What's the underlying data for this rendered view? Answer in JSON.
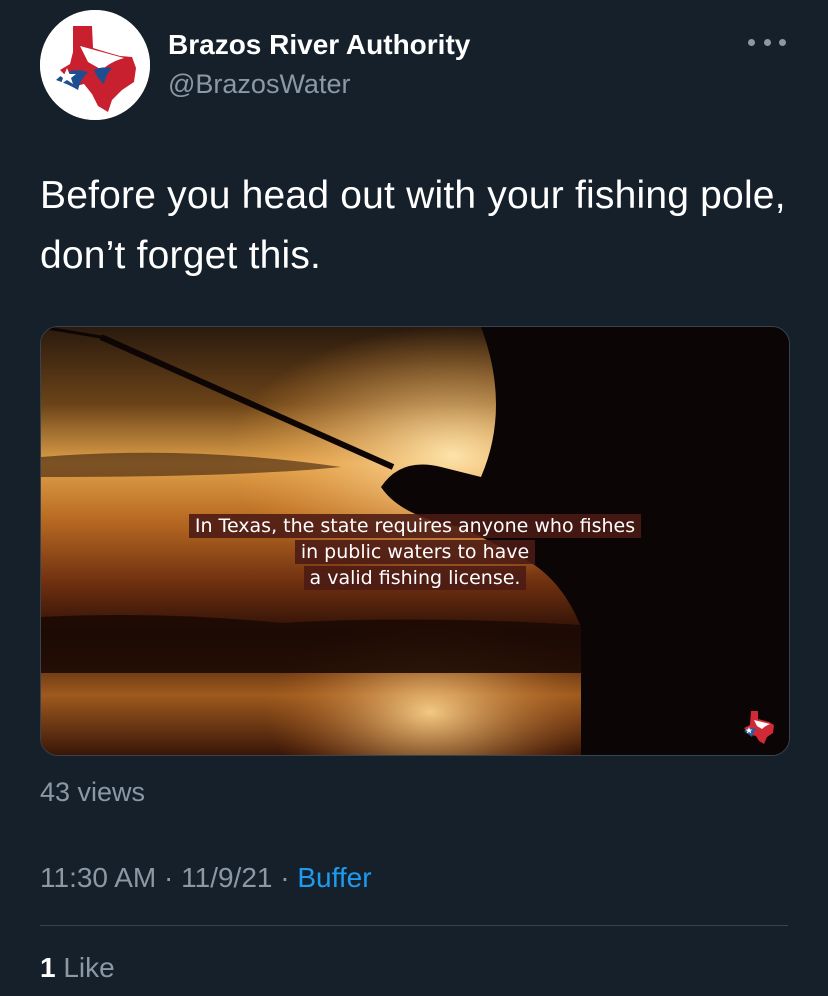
{
  "tweet": {
    "author": {
      "display_name": "Brazos River Authority",
      "handle": "@BrazosWater",
      "avatar_icon": "texas-flag-logo-icon"
    },
    "more_icon": "more-options-icon",
    "text": "Before you head out with your fishing pole, don’t forget this.",
    "media": {
      "caption_lines": [
        "In Texas, the state requires anyone who fishes",
        "in public waters to have",
        "a valid fishing license."
      ],
      "watermark_icon": "texas-flag-logo-icon"
    },
    "views": "43 views",
    "time": "11:30 AM",
    "separator": "·",
    "date": "11/9/21",
    "source": "Buffer",
    "likes": {
      "count": "1",
      "label": "Like"
    }
  },
  "colors": {
    "background": "#15202b",
    "secondary_text": "#8b98a5",
    "link": "#1d9bf0",
    "divider": "#38444d"
  }
}
